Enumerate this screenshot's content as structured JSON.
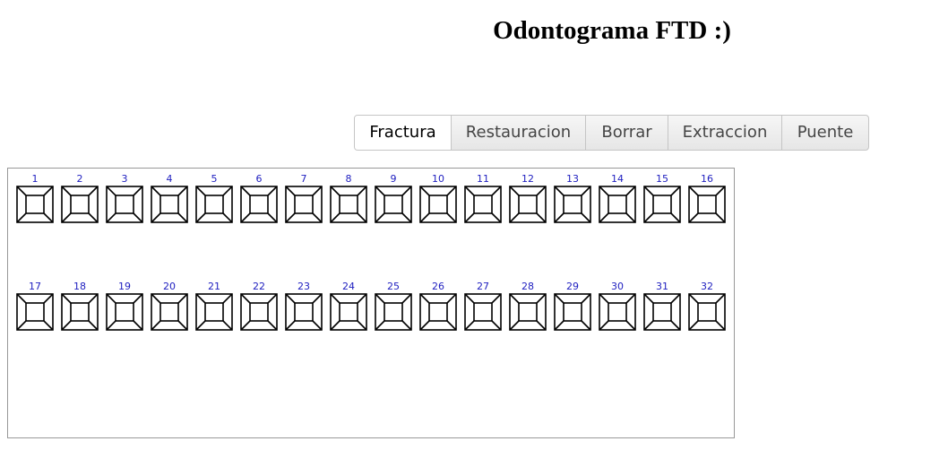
{
  "header": {
    "title": "Odontograma FTD :)"
  },
  "toolbar": {
    "buttons": [
      {
        "label": "Fractura",
        "active": true
      },
      {
        "label": "Restauracion",
        "active": false
      },
      {
        "label": "Borrar",
        "active": false
      },
      {
        "label": "Extraccion",
        "active": false
      },
      {
        "label": "Puente",
        "active": false
      }
    ]
  },
  "odontogram": {
    "number_color": "#2020c0",
    "rows": [
      [
        "1",
        "2",
        "3",
        "4",
        "5",
        "6",
        "7",
        "8",
        "9",
        "10",
        "11",
        "12",
        "13",
        "14",
        "15",
        "16"
      ],
      [
        "17",
        "18",
        "19",
        "20",
        "21",
        "22",
        "23",
        "24",
        "25",
        "26",
        "27",
        "28",
        "29",
        "30",
        "31",
        "32"
      ]
    ]
  }
}
